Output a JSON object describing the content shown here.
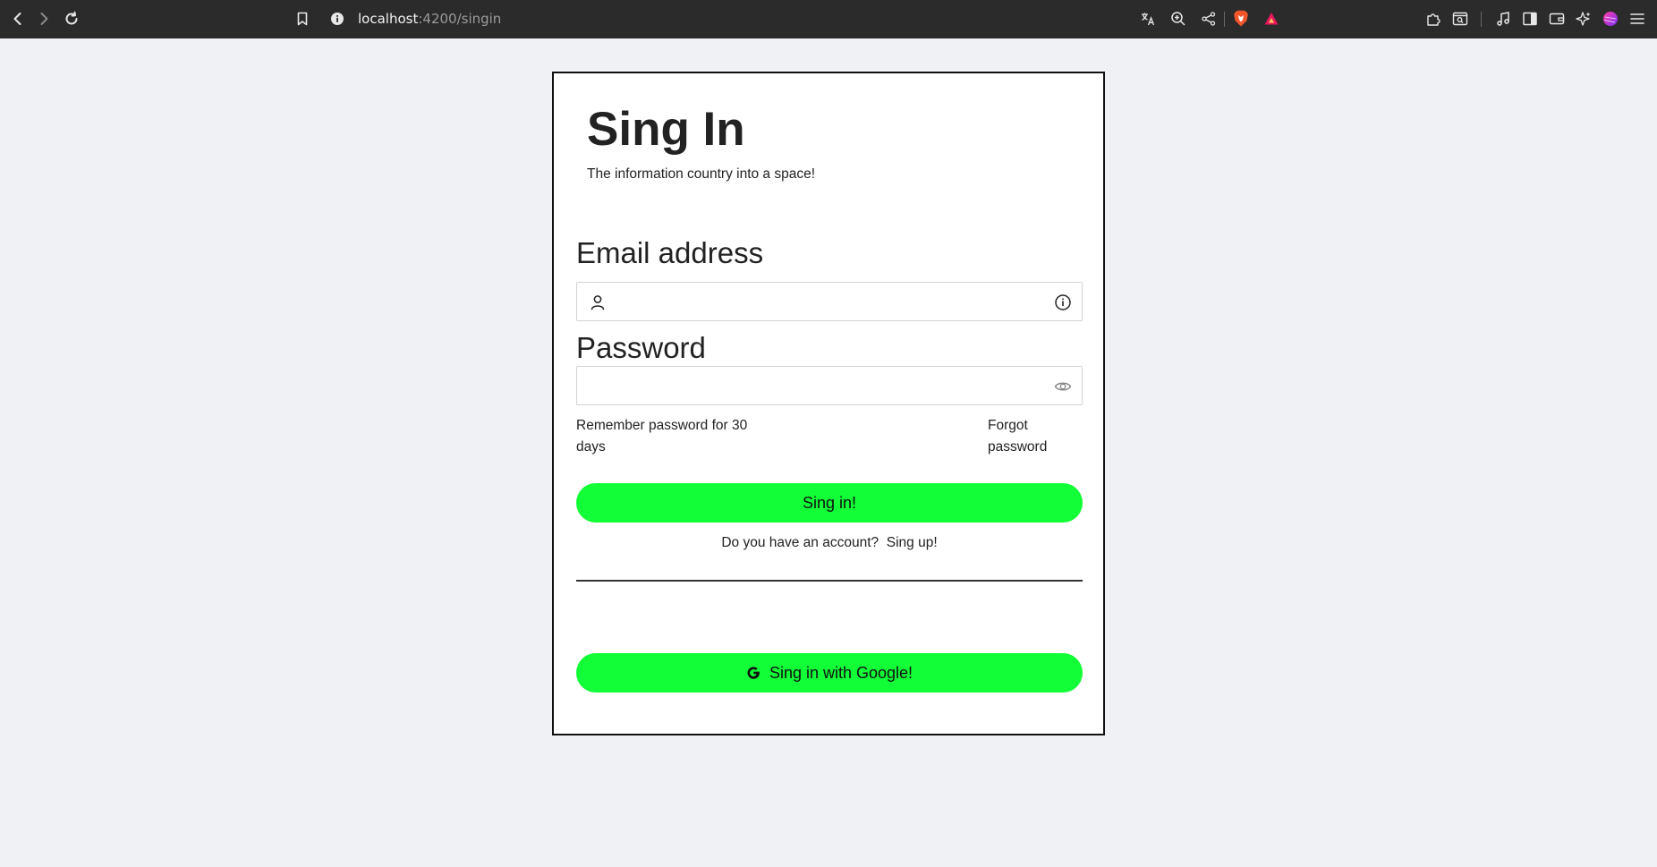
{
  "browser": {
    "url_host": "localhost",
    "url_rest": ":4200/singin",
    "icons": [
      "back-icon",
      "forward-icon",
      "reload-icon",
      "bookmark-icon",
      "site-info-icon",
      "translate-icon",
      "zoom-icon",
      "share-icon",
      "brave-shield-icon",
      "brave-rewards-icon",
      "extensions-icon",
      "tab-search-icon",
      "media-icon",
      "sidebar-icon",
      "wallet-icon",
      "leo-ai-icon",
      "profile-icon",
      "menu-icon"
    ]
  },
  "signin": {
    "title": "Sing In",
    "subtitle": "The information country into a space!",
    "email_label": "Email address",
    "email_value": "",
    "password_label": "Password",
    "password_value": "",
    "remember_label": "Remember password for 30 days",
    "forgot_label": "Forgot password",
    "signin_button": "Sing in!",
    "account_question": "Do you have an account?",
    "signup_link": "Sing up!",
    "google_button": "Sing in with Google!"
  },
  "colors": {
    "accent_green": "#12fe37",
    "page_background": "#f0f1f5",
    "chrome_background": "#2b2b2b"
  }
}
